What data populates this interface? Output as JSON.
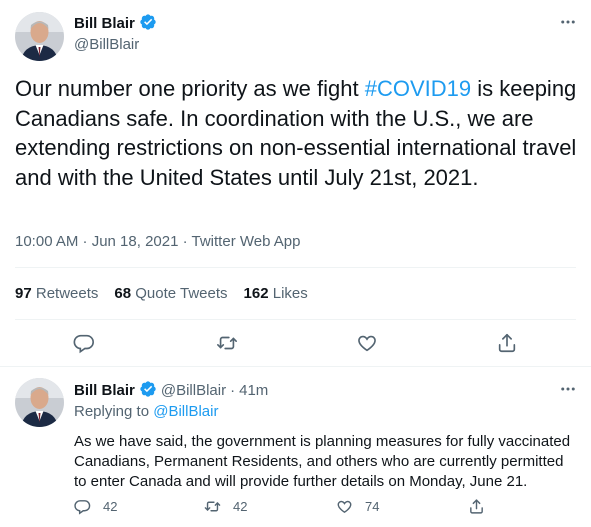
{
  "tweet": {
    "author_name": "Bill Blair",
    "author_handle": "@BillBlair",
    "text_before": "Our number one priority as we fight ",
    "hashtag": "#COVID19",
    "text_after": " is keeping Canadians safe. In coordination with the U.S., we are extending restrictions on non-essential international travel and with the United States until July 21st, 2021.",
    "time": "10:00 AM · Jun 18, 2021 · ",
    "source": "Twitter Web App",
    "stats": {
      "retweets_count": "97",
      "retweets_label": "Retweets",
      "quotes_count": "68",
      "quotes_label": "Quote Tweets",
      "likes_count": "162",
      "likes_label": "Likes"
    }
  },
  "reply": {
    "author_name": "Bill Blair",
    "author_handle": "@BillBlair",
    "dot": "·",
    "time": "41m",
    "replying_prefix": "Replying to ",
    "replying_handle": "@BillBlair",
    "text": "As we have said, the government is planning measures for fully vaccinated Canadians, Permanent Residents, and others who are currently permitted to enter Canada and will provide further details on Monday, June 21.",
    "reply_count": "42",
    "retweet_count": "42",
    "like_count": "74"
  },
  "colors": {
    "accent": "#1d9bf0",
    "secondary_text": "#536471",
    "primary_text": "#0f1419",
    "divider": "#eff3f4"
  },
  "icons": [
    "avatar",
    "verified-badge-icon",
    "more-icon",
    "reply-icon",
    "retweet-icon",
    "like-icon",
    "share-icon"
  ]
}
